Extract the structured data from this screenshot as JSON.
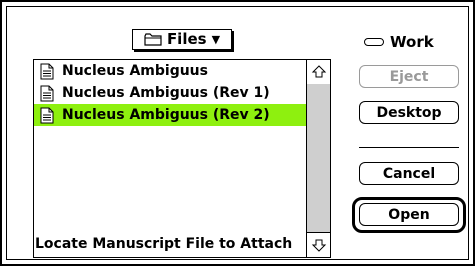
{
  "dialog": {
    "folder_popup_label": "Files",
    "volume_name": "Work",
    "prompt": "Locate Manuscript File to Attach"
  },
  "file_list": {
    "items": [
      {
        "name": "Nucleus Ambiguus",
        "selected": false,
        "icon": "document-icon"
      },
      {
        "name": "Nucleus Ambiguus (Rev 1)",
        "selected": false,
        "icon": "document-icon"
      },
      {
        "name": "Nucleus Ambiguus (Rev 2)",
        "selected": true,
        "icon": "document-icon"
      }
    ],
    "selection_color": "#8ef00f"
  },
  "buttons": {
    "eject": "Eject",
    "desktop": "Desktop",
    "cancel": "Cancel",
    "open": "Open"
  }
}
